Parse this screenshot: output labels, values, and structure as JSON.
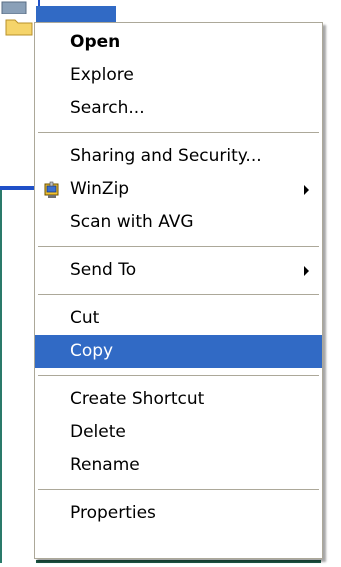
{
  "menu": {
    "items": [
      {
        "label": "Open",
        "bold": true
      },
      {
        "label": "Explore"
      },
      {
        "label": "Search..."
      },
      {
        "separator": true
      },
      {
        "label": "Sharing and Security..."
      },
      {
        "label": "WinZip",
        "icon": "winzip-icon",
        "submenu": true
      },
      {
        "label": "Scan with AVG"
      },
      {
        "separator": true
      },
      {
        "label": "Send To",
        "submenu": true
      },
      {
        "separator": true
      },
      {
        "label": "Cut"
      },
      {
        "label": "Copy",
        "selected": true
      },
      {
        "separator": true
      },
      {
        "label": "Create Shortcut"
      },
      {
        "label": "Delete"
      },
      {
        "label": "Rename"
      },
      {
        "separator": true
      },
      {
        "label": "Properties"
      }
    ]
  },
  "colors": {
    "selection": "#316ac5",
    "separator": "#aca899",
    "window_border": "#1f50c8"
  }
}
